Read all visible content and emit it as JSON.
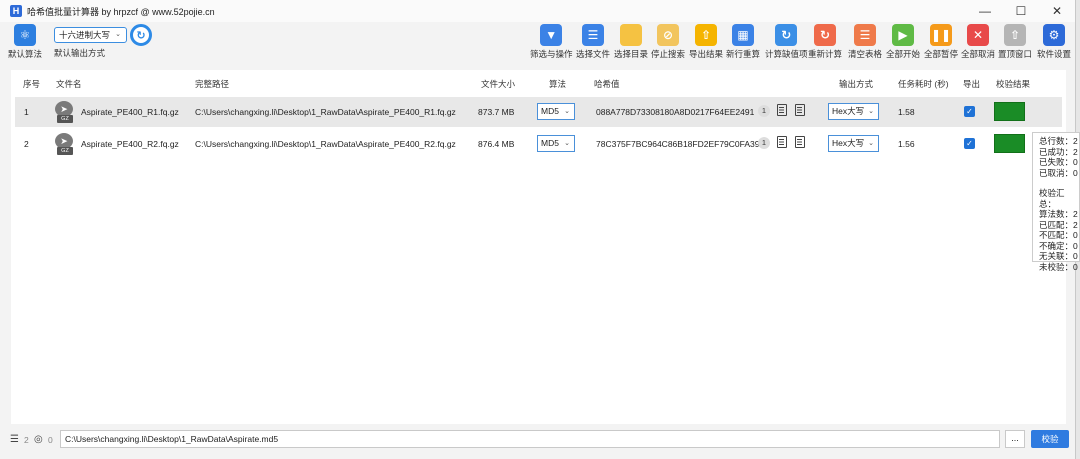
{
  "window": {
    "title": "哈希值批量计算器 by hrpzcf @ www.52pojie.cn",
    "app_icon_letter": "H"
  },
  "toolbar": {
    "algo_label": "默认算法",
    "mode_value": "十六进制大写",
    "mode_label": "默认输出方式",
    "buttons": [
      {
        "label": "筛选与操作",
        "icon": "funnel-icon",
        "color": "#3b82e6"
      },
      {
        "label": "选择文件",
        "icon": "file-list-icon",
        "color": "#3b82e6"
      },
      {
        "label": "选择目录",
        "icon": "folder-icon",
        "color": "#f5c242"
      },
      {
        "label": "停止搜索",
        "icon": "stop-search-icon",
        "color": "#f2c55e"
      },
      {
        "label": "导出结果",
        "icon": "export-icon",
        "color": "#f5b400"
      },
      {
        "label": "新行重算",
        "icon": "recalc-new-icon",
        "color": "#3b82e6"
      },
      {
        "label": "计算缺值项",
        "icon": "refresh-icon",
        "color": "#3b8fe6"
      },
      {
        "label": "重新计算",
        "icon": "recalculate-icon",
        "color": "#ef6a4a"
      },
      {
        "label": "清空表格",
        "icon": "basket-icon",
        "color": "#ef7a4a"
      },
      {
        "label": "全部开始",
        "icon": "play-icon",
        "color": "#5fba45"
      },
      {
        "label": "全部暂停",
        "icon": "pause-icon",
        "color": "#f59a1a"
      },
      {
        "label": "全部取消",
        "icon": "cancel-icon",
        "color": "#e84a4a"
      },
      {
        "label": "置顶窗口",
        "icon": "pin-top-icon",
        "color": "#b5b5b5"
      },
      {
        "label": "软件设置",
        "icon": "gear-icon",
        "color": "#2d6ad8"
      }
    ]
  },
  "table": {
    "headers": {
      "index": "序号",
      "filename": "文件名",
      "fullpath": "完整路径",
      "size": "文件大小",
      "algo": "算法",
      "hash": "哈希值",
      "output": "输出方式",
      "time": "任务耗时 (秒)",
      "export": "导出",
      "result": "校验结果"
    },
    "rows": [
      {
        "index": "1",
        "filename": "Aspirate_PE400_R1.fq.gz",
        "path": "C:\\Users\\changxing.li\\Desktop\\1_RawData\\Aspirate_PE400_R1.fq.gz",
        "size": "873.7 MB",
        "algo": "MD5",
        "hash": "088A778D73308180A8D0217F64EE2491",
        "badge": "1",
        "output": "Hex大写",
        "time": "1.58",
        "result_color": "#1a8c26"
      },
      {
        "index": "2",
        "filename": "Aspirate_PE400_R2.fq.gz",
        "path": "C:\\Users\\changxing.li\\Desktop\\1_RawData\\Aspirate_PE400_R2.fq.gz",
        "size": "876.4 MB",
        "algo": "MD5",
        "hash": "78C375F7BC964C86B18FD2EF79C0FA39",
        "badge": "1",
        "output": "Hex大写",
        "time": "1.56",
        "result_color": "#1a8c26"
      }
    ]
  },
  "summary": {
    "total": "总行数：2",
    "success": "已成功：2",
    "failed": "已失败：0",
    "cancelled": "已取消：0",
    "verify_title": "校验汇总：",
    "algo_count": "算法数：2",
    "matched": "已匹配：2",
    "mismatched": "不匹配：0",
    "uncertain": "不确定：0",
    "unlinked": "无关联：0",
    "unverified": "未校验：0"
  },
  "bottom": {
    "list_count": "2",
    "circle_count": "0",
    "path": "C:\\Users\\changxing.li\\Desktop\\1_RawData\\Aspirate.md5",
    "dots_label": "...",
    "verify_label": "校验"
  }
}
